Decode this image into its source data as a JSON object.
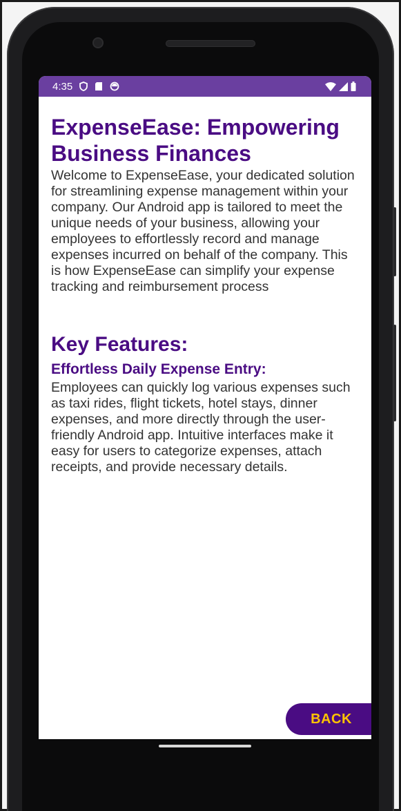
{
  "status_bar": {
    "time": "4:35",
    "icons_left": [
      "shield-icon",
      "sd-card-icon",
      "sync-icon"
    ],
    "icons_right": [
      "wifi-icon",
      "signal-icon",
      "battery-icon"
    ],
    "color": "#6a3fa0"
  },
  "intro": {
    "title": "ExpenseEase: Empowering Business Finances",
    "body": "Welcome to ExpenseEase, your dedicated solution for streamlining expense management within your company. Our Android app is tailored to meet the unique needs of your business, allowing your employees to effortlessly record and manage expenses incurred on behalf of the company. This is how ExpenseEase can simplify your expense tracking and reimbursement process"
  },
  "features": {
    "title": "Key Features:",
    "items": [
      {
        "title": "Effortless Daily Expense Entry:",
        "body": "Employees can quickly log various expenses such as taxi rides, flight tickets, hotel stays, dinner expenses, and more directly through the user-friendly Android app. Intuitive interfaces make it easy for users to categorize expenses, attach receipts, and provide necessary details."
      }
    ]
  },
  "back_button": {
    "label": "BACK"
  },
  "colors": {
    "accent": "#4a0c83",
    "button_text": "#ffc400",
    "body_text": "#333333"
  }
}
